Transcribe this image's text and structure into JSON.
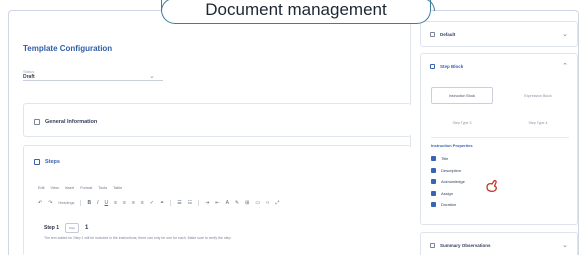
{
  "callout": {
    "title": "Document management"
  },
  "main": {
    "title": "Template Configuration",
    "status_label": "Status",
    "status_value": "Draft",
    "general_info": "General Information",
    "steps_title": "Steps",
    "menubar": [
      "Edit",
      "View",
      "Insert",
      "Format",
      "Tools",
      "Table"
    ],
    "toolbar": {
      "paragraph": "Headings"
    },
    "step": {
      "label": "Step 1",
      "box_text": "Step",
      "number": "1",
      "description": "The text added for Step 1 will be included in the instructions; there can only be one for each. Make sure to verify the step."
    }
  },
  "side": {
    "default_title": "Default",
    "step_block_title": "Step Block",
    "blocks": [
      "Instruction Block",
      "Expression Block",
      "Step Type 3",
      "Step Type 4"
    ],
    "props_title": "Instruction Properties",
    "props": [
      "Title",
      "Description",
      "Acknowledge",
      "Assign",
      "Duration"
    ],
    "summary_title": "Summary Observations"
  },
  "colors": {
    "accent": "#3963b4",
    "callout_border": "#3e7e9b"
  }
}
